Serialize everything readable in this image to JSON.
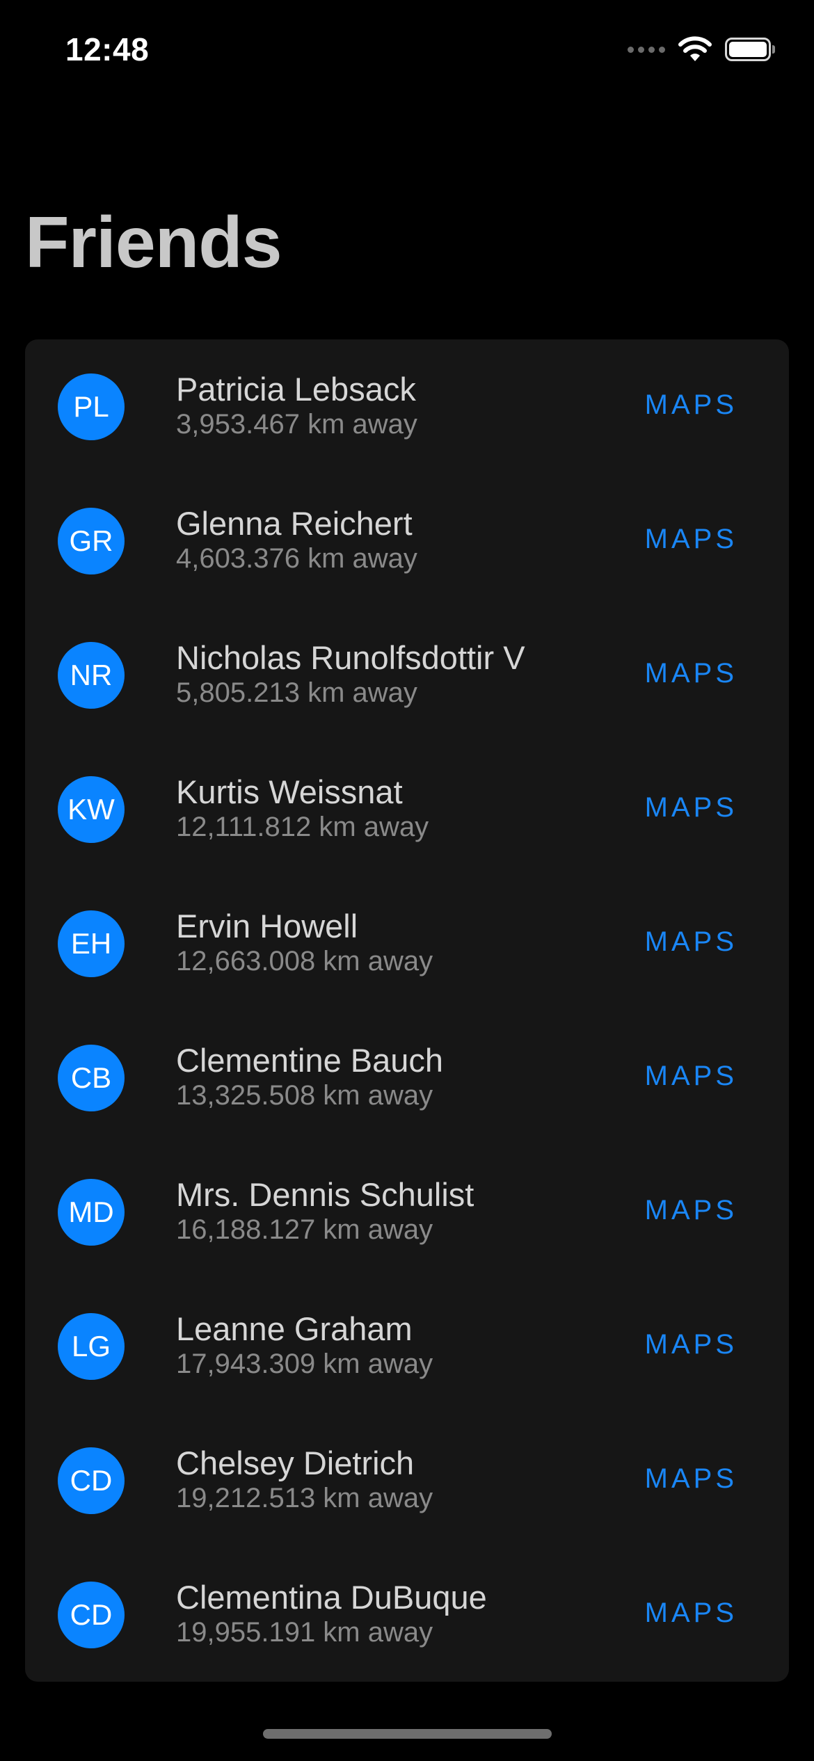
{
  "status_bar": {
    "time": "12:48"
  },
  "header": {
    "title": "Friends"
  },
  "friends": [
    {
      "initials": "PL",
      "name": "Patricia Lebsack",
      "distance": "3,953.467 km away",
      "action": "MAPS"
    },
    {
      "initials": "GR",
      "name": "Glenna Reichert",
      "distance": "4,603.376 km away",
      "action": "MAPS"
    },
    {
      "initials": "NR",
      "name": "Nicholas Runolfsdottir V",
      "distance": "5,805.213 km away",
      "action": "MAPS"
    },
    {
      "initials": "KW",
      "name": "Kurtis Weissnat",
      "distance": "12,111.812 km away",
      "action": "MAPS"
    },
    {
      "initials": "EH",
      "name": "Ervin Howell",
      "distance": "12,663.008 km away",
      "action": "MAPS"
    },
    {
      "initials": "CB",
      "name": "Clementine Bauch",
      "distance": "13,325.508 km away",
      "action": "MAPS"
    },
    {
      "initials": "MD",
      "name": "Mrs. Dennis Schulist",
      "distance": "16,188.127 km away",
      "action": "MAPS"
    },
    {
      "initials": "LG",
      "name": "Leanne Graham",
      "distance": "17,943.309 km away",
      "action": "MAPS"
    },
    {
      "initials": "CD",
      "name": "Chelsey Dietrich",
      "distance": "19,212.513 km away",
      "action": "MAPS"
    },
    {
      "initials": "CD",
      "name": "Clementina DuBuque",
      "distance": "19,955.191 km away",
      "action": "MAPS"
    }
  ],
  "colors": {
    "accent": "#0a84ff",
    "background": "#000000",
    "card": "#161616"
  },
  "icons": {
    "signal": "signal-dots-icon",
    "wifi": "wifi-icon",
    "battery": "battery-icon"
  }
}
